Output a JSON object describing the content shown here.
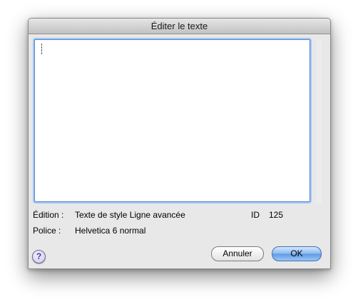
{
  "dialog": {
    "title": "Éditer le texte"
  },
  "editor": {
    "value": ""
  },
  "info": {
    "edition_label": "Édition :",
    "edition_value": "Texte de style Ligne avancée",
    "id_label": "ID",
    "id_value": "125",
    "police_label": "Police :",
    "police_value": "Helvetica 6 normal"
  },
  "buttons": {
    "help": "?",
    "cancel": "Annuler",
    "ok": "OK"
  }
}
